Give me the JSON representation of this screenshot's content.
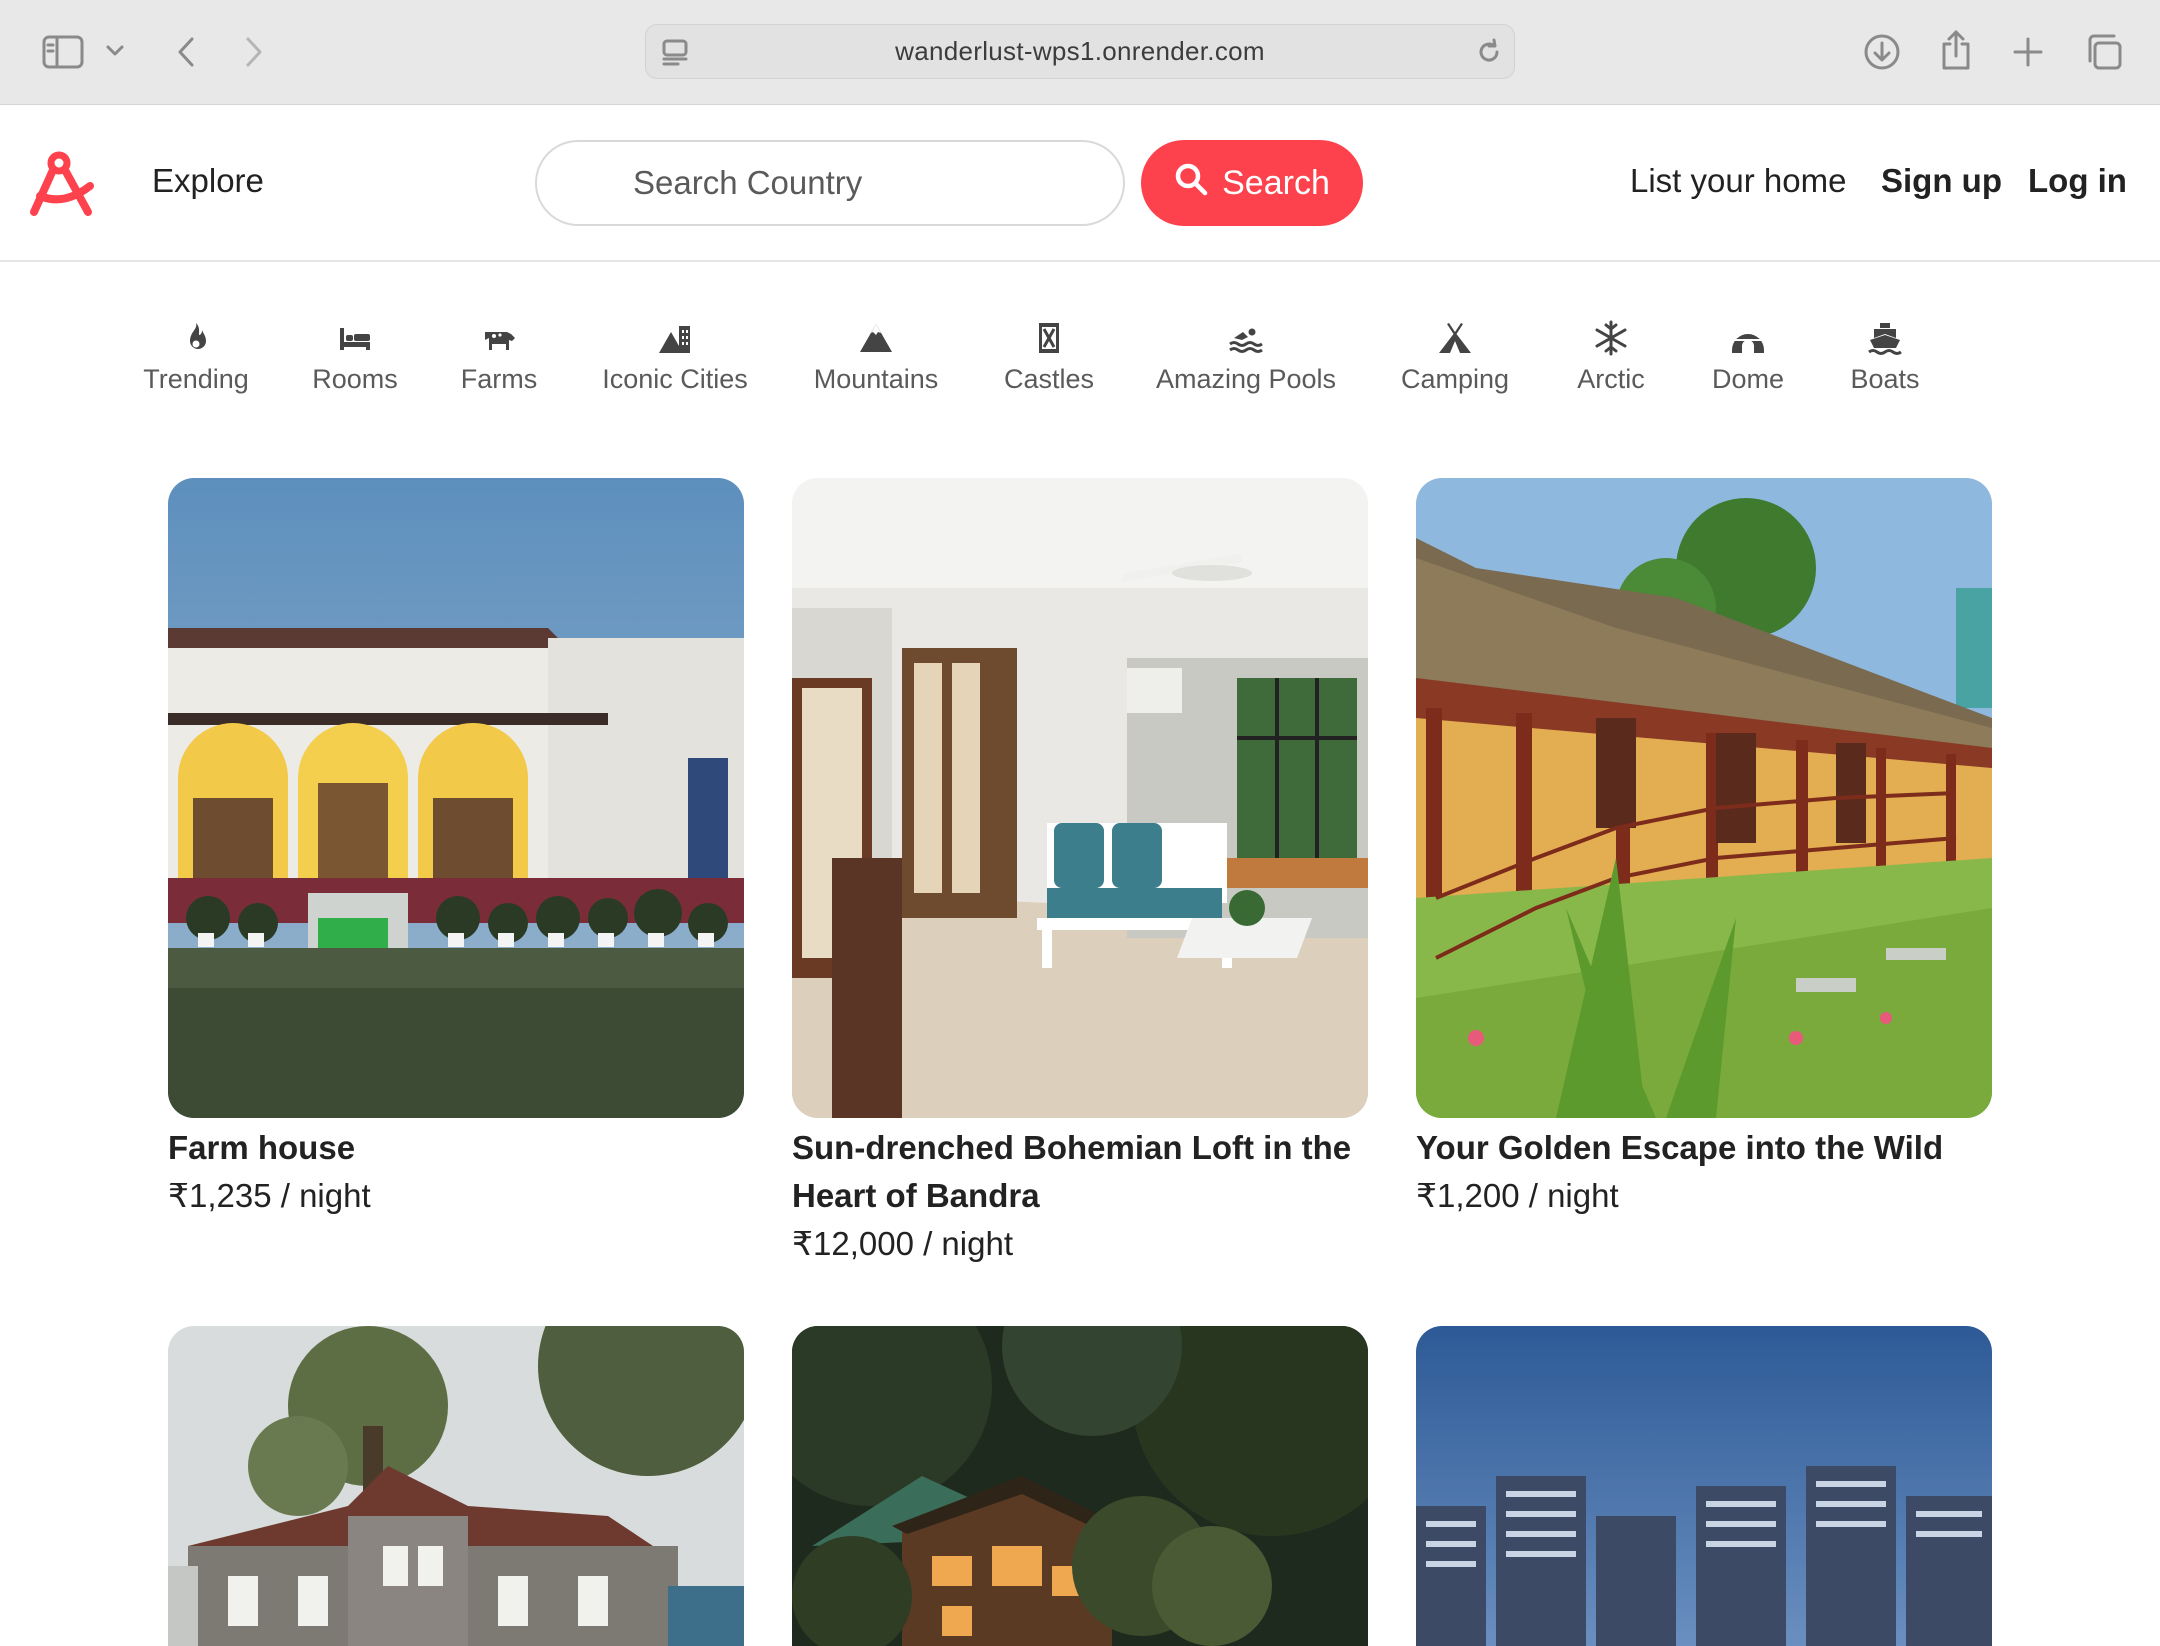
{
  "browser": {
    "url": "wanderlust-wps1.onrender.com"
  },
  "navbar": {
    "explore_label": "Explore",
    "search_placeholder": "Search Country",
    "search_button_label": "Search",
    "list_home_label": "List your home",
    "signup_label": "Sign up",
    "login_label": "Log in"
  },
  "filters": [
    {
      "label": "Trending",
      "icon": "fire-icon"
    },
    {
      "label": "Rooms",
      "icon": "bed-icon"
    },
    {
      "label": "Farms",
      "icon": "cow-icon"
    },
    {
      "label": "Iconic Cities",
      "icon": "city-icon"
    },
    {
      "label": "Mountains",
      "icon": "mountain-icon"
    },
    {
      "label": "Castles",
      "icon": "castle-icon"
    },
    {
      "label": "Amazing Pools",
      "icon": "swimmer-icon"
    },
    {
      "label": "Camping",
      "icon": "tent-icon"
    },
    {
      "label": "Arctic",
      "icon": "snowflake-icon"
    },
    {
      "label": "Dome",
      "icon": "igloo-icon"
    },
    {
      "label": "Boats",
      "icon": "ship-icon"
    }
  ],
  "listings": [
    {
      "title": "Farm house",
      "price": "₹1,235 / night"
    },
    {
      "title": "Sun-drenched Bohemian Loft in the Heart of Bandra",
      "price": "₹12,000 / night"
    },
    {
      "title": "Your Golden Escape into the Wild",
      "price": "₹1,200 / night"
    }
  ],
  "colors": {
    "brand": "#fe424d",
    "text": "#222222",
    "muted": "#5a5a5a"
  }
}
